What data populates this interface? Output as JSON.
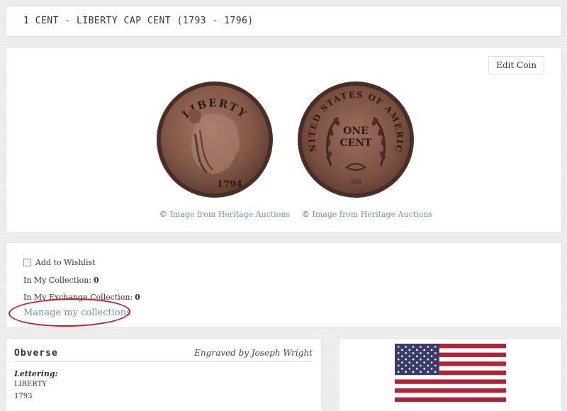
{
  "header": {
    "title": "1 CENT - LIBERTY CAP CENT (1793 - 1796)"
  },
  "images": {
    "edit_label": "Edit Coin",
    "obverse_credit": "Image from Heritage Auctions",
    "reverse_credit": "Image from Heritage Auctions",
    "copyright_symbol": "©",
    "obverse_inscription": "LIBERTY",
    "obverse_date": "1794",
    "reverse_inscription": "UNITED STATES OF AMERICA",
    "reverse_denomination_line1": "ONE",
    "reverse_denomination_line2": "CENT",
    "reverse_fraction": "100"
  },
  "collection": {
    "wishlist_label": "Add to Wishlist",
    "wishlist_checked": false,
    "in_collection_label": "In My Collection:",
    "in_collection_count": "0",
    "in_exchange_label": "In My Exchange Collection:",
    "in_exchange_count": "0",
    "manage_link": "Manage my collections"
  },
  "obverse": {
    "heading": "Obverse",
    "engraver": "Engraved by Joseph Wright",
    "lettering_label": "Lettering:",
    "lettering_lines": [
      "LIBERTY",
      "1793"
    ]
  },
  "colors": {
    "link": "#6e8fb8",
    "annotation": "#e0161e",
    "copper": "#8a5a48"
  },
  "icons": {
    "flag": "us-flag-icon",
    "checkbox": "checkbox-icon"
  }
}
